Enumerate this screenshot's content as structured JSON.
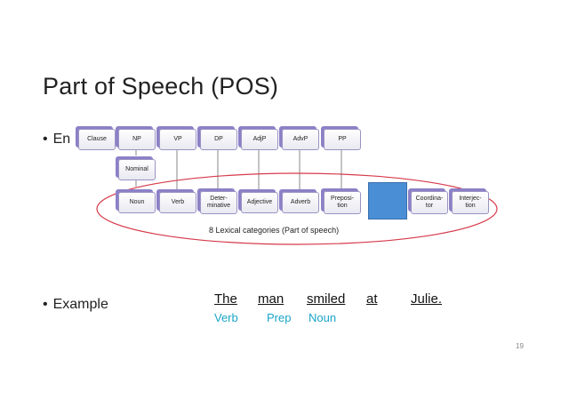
{
  "slide": {
    "title": "Part of Speech (POS)",
    "bullet1": "En",
    "bullet_marker": "•",
    "bullet2": "Example",
    "page_number": "19"
  },
  "diagram": {
    "phrase_row": [
      "Clause",
      "NP",
      "VP",
      "DP",
      "AdjP",
      "AdvP",
      "PP"
    ],
    "nominal": "Nominal",
    "lexical_row": [
      "Noun",
      "Verb",
      "Deter-\nminative",
      "Adjective",
      "Adverb",
      "Preposi-\ntion",
      "",
      "Coordina-\ntor",
      "Interjec-\ntion"
    ],
    "ellipse_label": "8 Lexical categories (Part of speech)",
    "colors": {
      "box_shadow": "#8c80c6",
      "ellipse": "#d63a4a",
      "blue_box": "#4a8fd6"
    }
  },
  "example": {
    "words": [
      "The",
      "man",
      "smiled",
      "at",
      "Julie."
    ],
    "tags": [
      "Verb",
      "Prep",
      "Noun"
    ],
    "tag_color": "#1aa5c8"
  }
}
